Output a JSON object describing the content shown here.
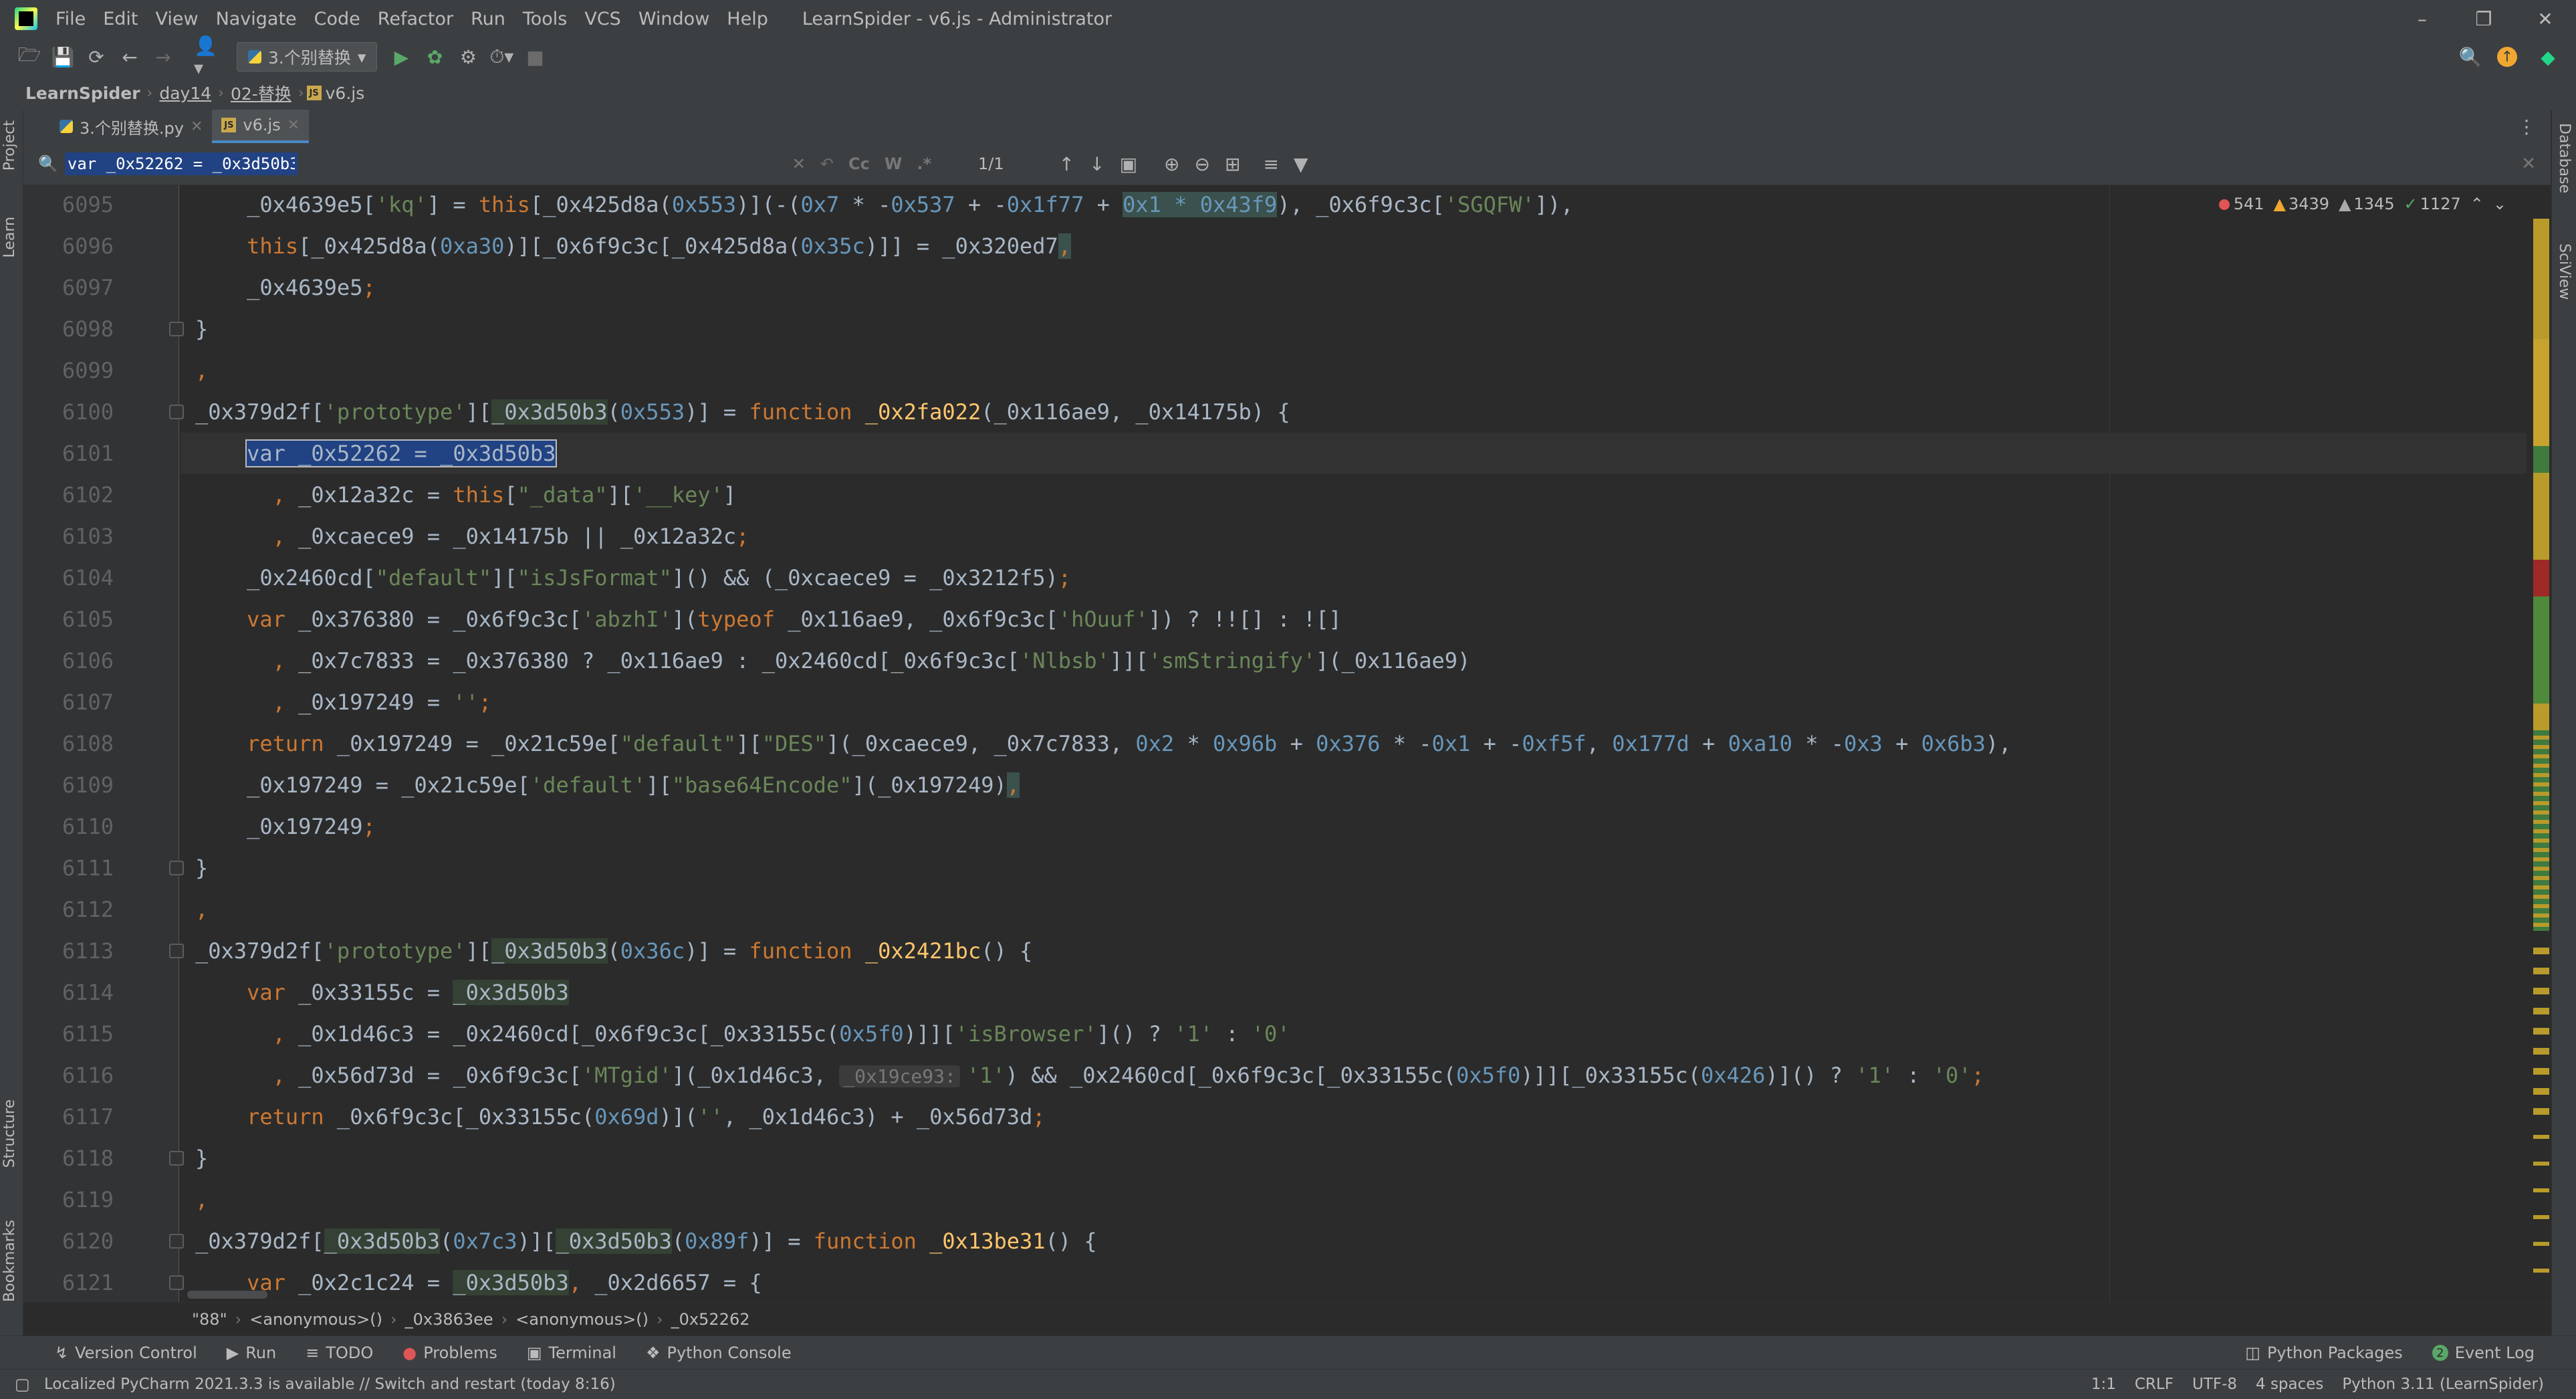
{
  "menubar": {
    "items": [
      "File",
      "Edit",
      "View",
      "Navigate",
      "Code",
      "Refactor",
      "Run",
      "Tools",
      "VCS",
      "Window",
      "Help"
    ],
    "title": "LearnSpider - v6.js - Administrator"
  },
  "toolbar": {
    "run_config": "3.个别替换"
  },
  "navbar": {
    "crumbs": [
      "LearnSpider",
      "day14",
      "02-替换",
      "v6.js"
    ]
  },
  "left_tools": [
    "Project",
    "Learn",
    "Structure",
    "Bookmarks"
  ],
  "right_tools": [
    "Database",
    "SciView"
  ],
  "editor_tabs": [
    {
      "label": "3.个别替换.py",
      "icon": "python-file-icon",
      "active": false
    },
    {
      "label": "v6.js",
      "icon": "js-file-icon",
      "active": true
    }
  ],
  "find": {
    "query": "var _0x52262 = _0x3d50b3",
    "count": "1/1",
    "options": [
      "Cc",
      "W",
      ".*"
    ]
  },
  "inspection": {
    "errors": "541",
    "warnings": "3439",
    "weak_warnings": "1345",
    "ok": "1127"
  },
  "code_lines": [
    {
      "n": "6095",
      "fold": false,
      "segs": [
        [
          "d",
          "    _0x4639e5["
        ],
        [
          "s",
          "'kq'"
        ],
        [
          "d",
          "] = "
        ],
        [
          "k",
          "this"
        ],
        [
          "d",
          "[_0x425d8a("
        ],
        [
          "n",
          "0x553"
        ],
        [
          "d",
          ")](-("
        ],
        [
          "n",
          "0x7"
        ],
        [
          "d",
          " * -"
        ],
        [
          "n",
          "0x537"
        ],
        [
          "d",
          " + -"
        ],
        [
          "n",
          "0x1f77"
        ],
        [
          "d",
          " + "
        ],
        [
          "nm",
          "0x1 * 0x43f9"
        ],
        [
          "d",
          "), _0x6f9c3c["
        ],
        [
          "s",
          "'SGQFW'"
        ],
        [
          "d",
          "]),"
        ]
      ]
    },
    {
      "n": "6096",
      "fold": false,
      "segs": [
        [
          "k",
          "    this"
        ],
        [
          "d",
          "[_0x425d8a("
        ],
        [
          "n",
          "0xa30"
        ],
        [
          "d",
          ")][_0x6f9c3c[_0x425d8a("
        ],
        [
          "n",
          "0x35c"
        ],
        [
          "d",
          ")]] = _0x320ed7"
        ],
        [
          "km",
          ","
        ]
      ]
    },
    {
      "n": "6097",
      "fold": false,
      "segs": [
        [
          "d",
          "    _0x4639e5"
        ],
        [
          "k",
          ";"
        ]
      ]
    },
    {
      "n": "6098",
      "fold": true,
      "segs": [
        [
          "d",
          "}"
        ]
      ]
    },
    {
      "n": "6099",
      "fold": false,
      "segs": [
        [
          "k",
          ","
        ]
      ]
    },
    {
      "n": "6100",
      "fold": true,
      "segs": [
        [
          "d",
          "_0x379d2f["
        ],
        [
          "s",
          "'prototype'"
        ],
        [
          "d",
          "]["
        ],
        [
          "o",
          "_0x3d50b3"
        ],
        [
          "d",
          "("
        ],
        [
          "n",
          "0x553"
        ],
        [
          "d",
          ")] = "
        ],
        [
          "k",
          "function "
        ],
        [
          "f",
          "_0x2fa022"
        ],
        [
          "d",
          "(_0x116ae9, _0x14175b) {"
        ]
      ]
    },
    {
      "n": "6101",
      "fold": false,
      "current": true,
      "segs": [
        [
          "d",
          "    "
        ],
        [
          "sel",
          "var _0x52262 = _0x3d50b3"
        ]
      ]
    },
    {
      "n": "6102",
      "fold": false,
      "segs": [
        [
          "k",
          "      , "
        ],
        [
          "d",
          "_0x12a32c = "
        ],
        [
          "k",
          "this"
        ],
        [
          "d",
          "["
        ],
        [
          "s",
          "\"_data\""
        ],
        [
          "d",
          "]["
        ],
        [
          "s",
          "'__key'"
        ],
        [
          "d",
          "]"
        ]
      ]
    },
    {
      "n": "6103",
      "fold": false,
      "segs": [
        [
          "k",
          "      , "
        ],
        [
          "d",
          "_0xcaece9 = _0x14175b || _0x12a32c"
        ],
        [
          "k",
          ";"
        ]
      ]
    },
    {
      "n": "6104",
      "fold": false,
      "segs": [
        [
          "d",
          "    _0x2460cd["
        ],
        [
          "s",
          "\"default\""
        ],
        [
          "d",
          "]["
        ],
        [
          "s",
          "\"isJsFormat\""
        ],
        [
          "d",
          "]() && (_0xcaece9 = _0x3212f5)"
        ],
        [
          "k",
          ";"
        ]
      ]
    },
    {
      "n": "6105",
      "fold": false,
      "segs": [
        [
          "k",
          "    var "
        ],
        [
          "d",
          "_0x376380 = _0x6f9c3c["
        ],
        [
          "s",
          "'abzhI'"
        ],
        [
          "d",
          "]("
        ],
        [
          "k",
          "typeof "
        ],
        [
          "d",
          "_0x116ae9, _0x6f9c3c["
        ],
        [
          "s",
          "'hOuuf'"
        ],
        [
          "d",
          "]) ? !![] : ![]"
        ]
      ]
    },
    {
      "n": "6106",
      "fold": false,
      "segs": [
        [
          "k",
          "      , "
        ],
        [
          "d",
          "_0x7c7833 = _0x376380 ? _0x116ae9 : _0x2460cd[_0x6f9c3c["
        ],
        [
          "s",
          "'Nlbsb'"
        ],
        [
          "d",
          "]]["
        ],
        [
          "s",
          "'smStringify'"
        ],
        [
          "d",
          "](_0x116ae9)"
        ]
      ]
    },
    {
      "n": "6107",
      "fold": false,
      "segs": [
        [
          "k",
          "      , "
        ],
        [
          "d",
          "_0x197249 = "
        ],
        [
          "s",
          "''"
        ],
        [
          "k",
          ";"
        ]
      ]
    },
    {
      "n": "6108",
      "fold": false,
      "segs": [
        [
          "k",
          "    return "
        ],
        [
          "d",
          "_0x197249 = _0x21c59e["
        ],
        [
          "s",
          "\"default\""
        ],
        [
          "d",
          "]["
        ],
        [
          "s",
          "\"DES\""
        ],
        [
          "d",
          "](_0xcaece9, _0x7c7833, "
        ],
        [
          "n",
          "0x2"
        ],
        [
          "d",
          " * "
        ],
        [
          "n",
          "0x96b"
        ],
        [
          "d",
          " + "
        ],
        [
          "n",
          "0x376"
        ],
        [
          "d",
          " * -"
        ],
        [
          "n",
          "0x1"
        ],
        [
          "d",
          " + -"
        ],
        [
          "n",
          "0xf5f"
        ],
        [
          "d",
          ", "
        ],
        [
          "n",
          "0x177d"
        ],
        [
          "d",
          " + "
        ],
        [
          "n",
          "0xa10"
        ],
        [
          "d",
          " * -"
        ],
        [
          "n",
          "0x3"
        ],
        [
          "d",
          " + "
        ],
        [
          "n",
          "0x6b3"
        ],
        [
          "d",
          "),"
        ]
      ]
    },
    {
      "n": "6109",
      "fold": false,
      "segs": [
        [
          "d",
          "    _0x197249 = _0x21c59e["
        ],
        [
          "s",
          "'default'"
        ],
        [
          "d",
          "]["
        ],
        [
          "s",
          "\"base64Encode\""
        ],
        [
          "d",
          "](_0x197249)"
        ],
        [
          "km",
          ","
        ]
      ]
    },
    {
      "n": "6110",
      "fold": false,
      "segs": [
        [
          "d",
          "    _0x197249"
        ],
        [
          "k",
          ";"
        ]
      ]
    },
    {
      "n": "6111",
      "fold": true,
      "segs": [
        [
          "d",
          "}"
        ]
      ]
    },
    {
      "n": "6112",
      "fold": false,
      "segs": [
        [
          "k",
          ","
        ]
      ]
    },
    {
      "n": "6113",
      "fold": true,
      "segs": [
        [
          "d",
          "_0x379d2f["
        ],
        [
          "s",
          "'prototype'"
        ],
        [
          "d",
          "]["
        ],
        [
          "o",
          "_0x3d50b3"
        ],
        [
          "d",
          "("
        ],
        [
          "n",
          "0x36c"
        ],
        [
          "d",
          ")] = "
        ],
        [
          "k",
          "function "
        ],
        [
          "f",
          "_0x2421bc"
        ],
        [
          "d",
          "() {"
        ]
      ]
    },
    {
      "n": "6114",
      "fold": false,
      "segs": [
        [
          "k",
          "    var "
        ],
        [
          "d",
          "_0x33155c = "
        ],
        [
          "o",
          "_0x3d50b3"
        ]
      ]
    },
    {
      "n": "6115",
      "fold": false,
      "segs": [
        [
          "k",
          "      , "
        ],
        [
          "d",
          "_0x1d46c3 = _0x2460cd[_0x6f9c3c[_0x33155c("
        ],
        [
          "n",
          "0x5f0"
        ],
        [
          "d",
          ")]]["
        ],
        [
          "s",
          "'isBrowser'"
        ],
        [
          "d",
          "]() ? "
        ],
        [
          "s",
          "'1'"
        ],
        [
          "d",
          " : "
        ],
        [
          "s",
          "'0'"
        ]
      ]
    },
    {
      "n": "6116",
      "fold": false,
      "segs": [
        [
          "k",
          "      , "
        ],
        [
          "d",
          "_0x56d73d = _0x6f9c3c["
        ],
        [
          "s",
          "'MTgid'"
        ],
        [
          "d",
          "](_0x1d46c3, "
        ],
        [
          "h",
          "_0x19ce93:"
        ],
        [
          "s",
          "'1'"
        ],
        [
          "d",
          ") && _0x2460cd[_0x6f9c3c[_0x33155c("
        ],
        [
          "n",
          "0x5f0"
        ],
        [
          "d",
          ")]][_0x33155c("
        ],
        [
          "n",
          "0x426"
        ],
        [
          "d",
          ")]() ? "
        ],
        [
          "s",
          "'1'"
        ],
        [
          "d",
          " : "
        ],
        [
          "s",
          "'0'"
        ],
        [
          "k",
          ";"
        ]
      ]
    },
    {
      "n": "6117",
      "fold": false,
      "segs": [
        [
          "k",
          "    return "
        ],
        [
          "d",
          "_0x6f9c3c[_0x33155c("
        ],
        [
          "n",
          "0x69d"
        ],
        [
          "d",
          ")]("
        ],
        [
          "s",
          "''"
        ],
        [
          "d",
          ", _0x1d46c3) + _0x56d73d"
        ],
        [
          "k",
          ";"
        ]
      ]
    },
    {
      "n": "6118",
      "fold": true,
      "segs": [
        [
          "d",
          "}"
        ]
      ]
    },
    {
      "n": "6119",
      "fold": false,
      "segs": [
        [
          "k",
          ","
        ]
      ]
    },
    {
      "n": "6120",
      "fold": true,
      "segs": [
        [
          "d",
          "_0x379d2f["
        ],
        [
          "o",
          "_0x3d50b3"
        ],
        [
          "d",
          "("
        ],
        [
          "n",
          "0x7c3"
        ],
        [
          "d",
          ")]["
        ],
        [
          "o",
          "_0x3d50b3"
        ],
        [
          "d",
          "("
        ],
        [
          "n",
          "0x89f"
        ],
        [
          "d",
          ")] = "
        ],
        [
          "k",
          "function "
        ],
        [
          "f",
          "_0x13be31"
        ],
        [
          "d",
          "() {"
        ]
      ]
    },
    {
      "n": "6121",
      "fold": true,
      "segs": [
        [
          "k",
          "    var "
        ],
        [
          "d",
          "_0x2c1c24 = "
        ],
        [
          "o",
          "_0x3d50b3"
        ],
        [
          "k",
          ", "
        ],
        [
          "d",
          "_0x2d6657 = {"
        ]
      ]
    }
  ],
  "editor_breadcrumbs": [
    "\"88\"",
    "<anonymous>()",
    "_0x3863ee",
    "<anonymous>()",
    "_0x52262"
  ],
  "tool_windows_left": [
    {
      "label": "Version Control",
      "icon": "vcs-icon"
    },
    {
      "label": "Run",
      "icon": "run-icon"
    },
    {
      "label": "TODO",
      "icon": "list-icon"
    },
    {
      "label": "Problems",
      "icon": "problems-icon"
    },
    {
      "label": "Terminal",
      "icon": "terminal-icon"
    },
    {
      "label": "Python Console",
      "icon": "python-icon"
    }
  ],
  "tool_windows_right": [
    {
      "label": "Python Packages",
      "icon": "packages-icon"
    },
    {
      "label": "Event Log",
      "icon": "event-log-icon",
      "badge": "2"
    }
  ],
  "status": {
    "message": "Localized PyCharm 2021.3.3 is available // Switch and restart (today 8:16)",
    "position": "1:1",
    "line_sep": "CRLF",
    "encoding": "UTF-8",
    "indent": "4 spaces",
    "interpreter": "Python 3.11 (LearnSpider)"
  },
  "colors": {
    "keyword": "#cc7832",
    "string": "#6a8759",
    "number": "#6897bb",
    "function": "#ffc66d",
    "default": "#a9b7c6",
    "background": "#2b2b2b",
    "chrome": "#3c3f41"
  }
}
